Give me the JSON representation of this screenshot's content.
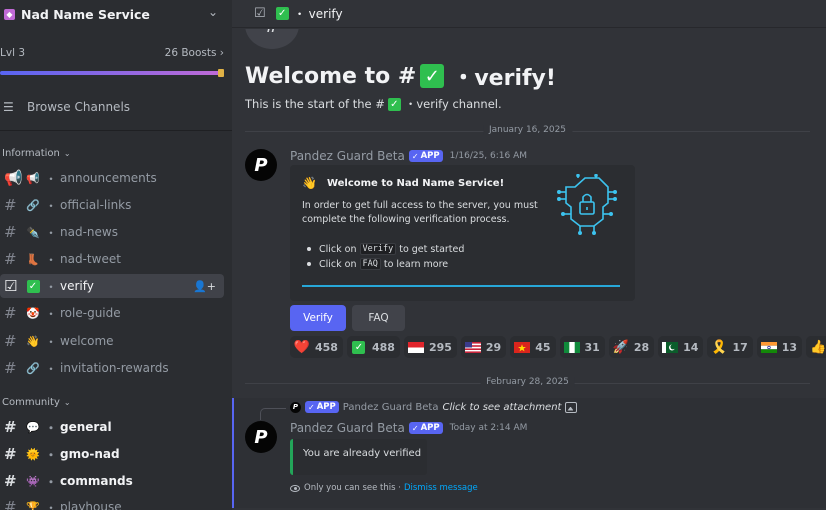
{
  "server": {
    "name": "Nad Name Service",
    "level": "Lvl 3",
    "boosts": "26 Boosts"
  },
  "sidebar": {
    "browse_label": "Browse Channels",
    "categories": [
      {
        "label": "Information"
      },
      {
        "label": "Community"
      }
    ],
    "channels": [
      {
        "emoji": "📢",
        "name": "announcements"
      },
      {
        "emoji": "🔗",
        "name": "official-links"
      },
      {
        "emoji": "✒️",
        "name": "nad-news"
      },
      {
        "emoji": "👢",
        "name": "nad-tweet"
      },
      {
        "emoji": "✅",
        "name": "verify"
      },
      {
        "emoji": "🤡",
        "name": "role-guide"
      },
      {
        "emoji": "👋",
        "name": "welcome"
      },
      {
        "emoji": "🔗",
        "name": "invitation-rewards"
      },
      {
        "emoji": "💬",
        "name": "general"
      },
      {
        "emoji": "🌞",
        "name": "gmo-nad"
      },
      {
        "emoji": "👾",
        "name": "commands"
      },
      {
        "emoji": "🏆",
        "name": "playhouse"
      }
    ]
  },
  "header": {
    "channel_name": "verify",
    "separator": "・"
  },
  "welcome": {
    "title_prefix": "Welcome to #",
    "title_suffix": "・verify!",
    "subtitle_prefix": "This is the start of the #",
    "subtitle_suffix": "・verify channel."
  },
  "messages": {
    "date1": "January 16, 2025",
    "date2": "February 28, 2025",
    "author": "Pandez Guard Beta",
    "app_badge": "APP",
    "timestamp1": "1/16/25, 6:16 AM",
    "embed": {
      "title": "Welcome to Nad Name Service!",
      "description": "In order to get full access to the server, you must complete the following verification process.",
      "step1_before": "Click on",
      "step1_code": "Verify",
      "step1_after": "to get started",
      "step2_before": "Click on",
      "step2_code": "FAQ",
      "step2_after": "to learn more"
    },
    "buttons": {
      "verify": "Verify",
      "faq": "FAQ"
    },
    "reactions": [
      {
        "emoji": "❤️",
        "count": "458"
      },
      {
        "emoji": "✅",
        "count": "488"
      },
      {
        "emoji": "🇮🇩",
        "count": "295"
      },
      {
        "emoji": "🇺🇸",
        "count": "29"
      },
      {
        "emoji": "🇻🇳",
        "count": "45"
      },
      {
        "emoji": "🇳🇬",
        "count": "31"
      },
      {
        "emoji": "🚀",
        "count": "28"
      },
      {
        "emoji": "🇵🇰",
        "count": "14"
      },
      {
        "emoji": "🎗️",
        "count": "17"
      },
      {
        "emoji": "🇮🇳",
        "count": "13"
      }
    ],
    "reply_text": "Click to see attachment",
    "timestamp2": "Today at 2:14 AM",
    "verified_text": "You are already verified",
    "ephemeral_text": "Only you can see this ·",
    "dismiss_text": "Dismiss message"
  },
  "colors": {
    "accent": "#5865f2",
    "embed_line": "#27a7d8",
    "success": "#23a559"
  }
}
